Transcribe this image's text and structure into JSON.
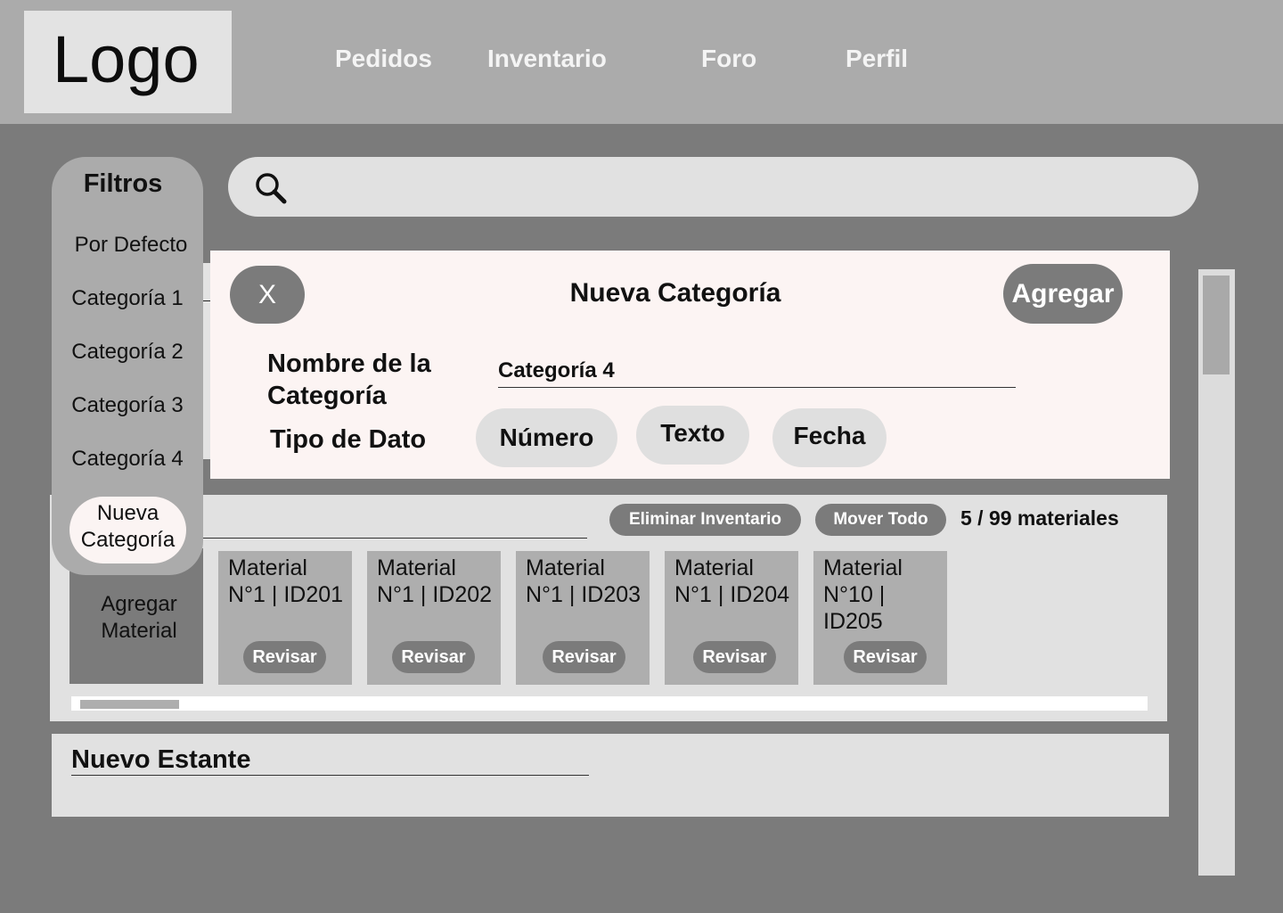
{
  "header": {
    "logo": "Logo",
    "nav": [
      "Pedidos",
      "Inventario",
      "Foro",
      "Perfil"
    ]
  },
  "filters": {
    "title": "Filtros",
    "items": [
      "Por Defecto",
      "Categoría 1",
      "Categoría 2",
      "Categoría 3",
      "Categoría 4"
    ],
    "new_button": "Nueva Categoría"
  },
  "search": {
    "placeholder": ""
  },
  "modal": {
    "close_label": "X",
    "title": "Nueva Categoría",
    "add_label": "Agregar",
    "name_label": "Nombre de la Categoría",
    "name_value": "Categoría 4",
    "type_label": "Tipo de Dato",
    "types": [
      "Número",
      "Texto",
      "Fecha"
    ]
  },
  "shelf": {
    "delete_label": "Eliminar Inventario",
    "move_label": "Mover Todo",
    "count_text": "5 / 99 materiales",
    "add_material_label": "Agregar Material",
    "materials": [
      {
        "label": "Material N°1 | ID201",
        "action": "Revisar"
      },
      {
        "label": "Material N°1 | ID202",
        "action": "Revisar"
      },
      {
        "label": "Material N°1 | ID203",
        "action": "Revisar"
      },
      {
        "label": "Material N°1 | ID204",
        "action": "Revisar"
      },
      {
        "label": "Material N°10 | ID205",
        "action": "Revisar"
      }
    ]
  },
  "new_shelf": {
    "title": "Nuevo Estante"
  }
}
